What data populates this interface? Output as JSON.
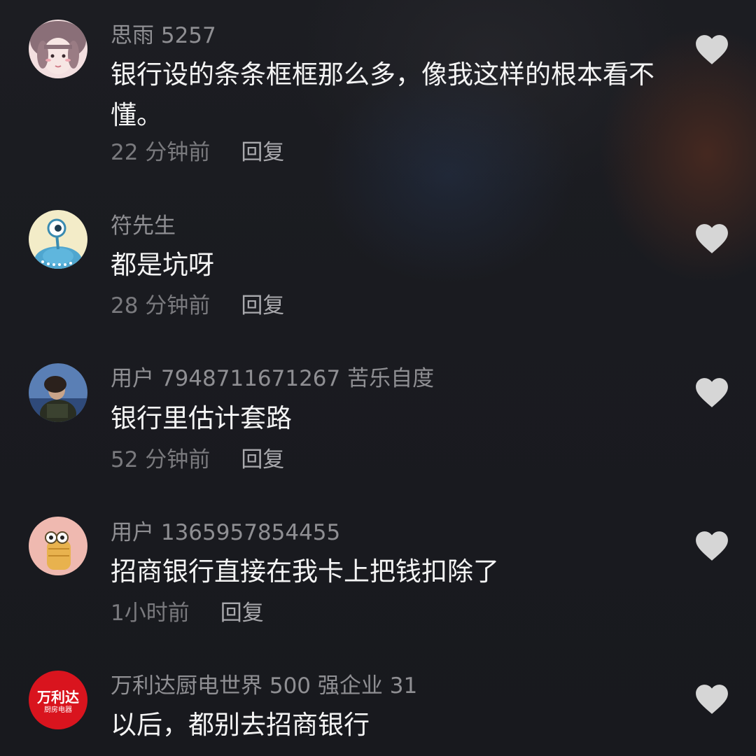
{
  "comments": [
    {
      "username": "思雨 5257",
      "text": "银行设的条条框框那么多，像我这样的根本看不懂。",
      "time": "22 分钟前",
      "reply": "回复",
      "avatar_icon": "girl-photo-avatar"
    },
    {
      "username": "符先生",
      "text": "都是坑呀",
      "time": "28 分钟前",
      "reply": "回复",
      "avatar_icon": "alien-cartoon-avatar"
    },
    {
      "username": "用户 7948711671267 苦乐自度",
      "text": "银行里估计套路",
      "time": "52 分钟前",
      "reply": "回复",
      "avatar_icon": "person-photo-avatar"
    },
    {
      "username": "用户 1365957854455",
      "text": "招商银行直接在我卡上把钱扣除了",
      "time": "1小时前",
      "reply": "回复",
      "avatar_icon": "cartoon-character-avatar"
    },
    {
      "username": "万利达厨电世界 500 强企业 31",
      "text": "以后，都别去招商银行",
      "avatar_icon": "brand-logo-avatar",
      "avatar_logo_text": "万利达",
      "avatar_logo_subtext": "厨房电器"
    }
  ],
  "colors": {
    "background": "#1a1b20",
    "username": "#8f8f93",
    "text": "#f4f4f4",
    "meta": "#7a7a7e",
    "heart": "#d6d6d6",
    "brand_red": "#d9141e"
  }
}
